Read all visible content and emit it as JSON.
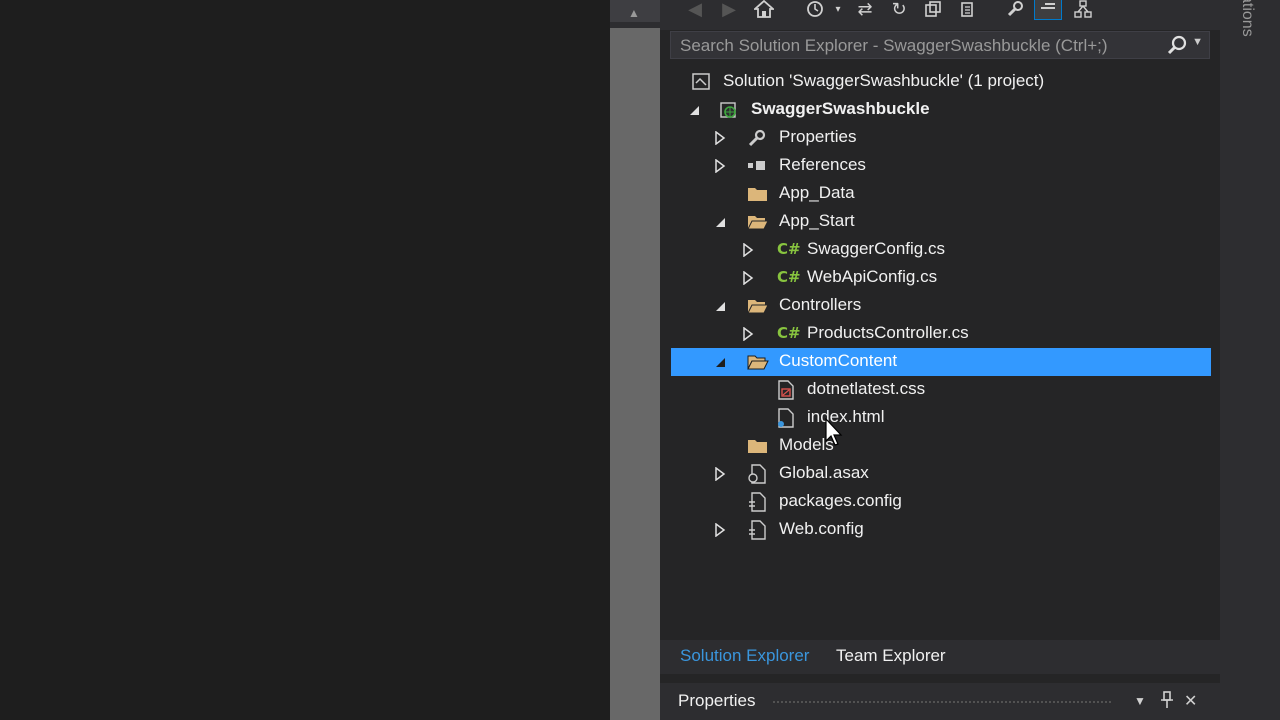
{
  "search": {
    "placeholder": "Search Solution Explorer - SwaggerSwashbuckle (Ctrl+;)"
  },
  "toolbar": {
    "icons": [
      "back-icon",
      "forward-icon",
      "home-icon",
      "history-icon",
      "sync-icon",
      "refresh-icon",
      "collapse-icon",
      "copy-icon",
      "properties-wrench-icon",
      "preview-icon",
      "class-diagram-icon"
    ]
  },
  "tree": {
    "solution": "Solution 'SwaggerSwashbuckle' (1 project)",
    "project": "SwaggerSwashbuckle",
    "properties": "Properties",
    "references": "References",
    "app_data": "App_Data",
    "app_start": "App_Start",
    "swagger_config": "SwaggerConfig.cs",
    "webapi_config": "WebApiConfig.cs",
    "controllers": "Controllers",
    "products_controller": "ProductsController.cs",
    "custom_content": "CustomContent",
    "css_file": "dotnetlatest.css",
    "index_file": "index.html",
    "models": "Models",
    "global_asax": "Global.asax",
    "packages_config": "packages.config",
    "web_config": "Web.config",
    "csharp_glyph": "C#"
  },
  "tabs": {
    "solution_explorer": "Solution Explorer",
    "team_explorer": "Team Explorer"
  },
  "properties_panel": {
    "title": "Properties"
  },
  "side_tab": {
    "label": "ations"
  },
  "colors": {
    "selection": "#3399ff",
    "accent": "#007acc",
    "folder": "#dcb67a",
    "csharp": "#88c43f"
  }
}
